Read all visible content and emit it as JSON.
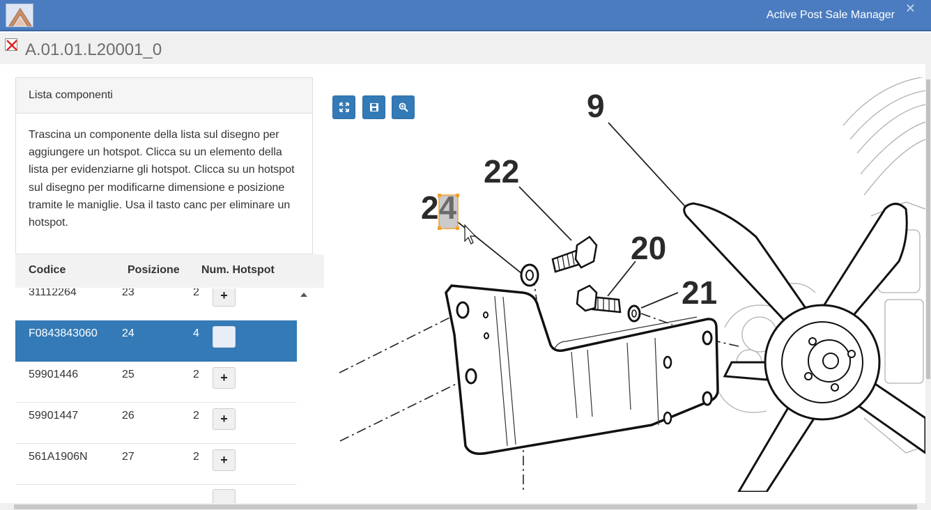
{
  "app": {
    "title": "Active Post Sale Manager",
    "close_glyph": "✕"
  },
  "document": {
    "title": "A.01.01.L20001_0"
  },
  "panel": {
    "heading": "Lista componenti",
    "instructions": "Trascina un componente della lista sul disegno per aggiungere un hotspot. Clicca su un elemento della lista per evidenziarne gli hotspot. Clicca su un hotspot sul disegno per modificarne dimensione e posizione tramite le maniglie. Usa il tasto canc per eliminare un hotspot."
  },
  "table": {
    "columns": [
      "Codice",
      "Posizione",
      "Num. Hotspot"
    ],
    "rows": [
      {
        "code": "31112264",
        "position": "23",
        "hotspots": "2",
        "button": "+"
      },
      {
        "code": "F0843843060",
        "position": "24",
        "hotspots": "4",
        "button": "+",
        "selected": true
      },
      {
        "code": "59901446",
        "position": "25",
        "hotspots": "2",
        "button": "+"
      },
      {
        "code": "59901447",
        "position": "26",
        "hotspots": "2",
        "button": "+"
      },
      {
        "code": "561A1906N",
        "position": "27",
        "hotspots": "2",
        "button": "+"
      }
    ]
  },
  "toolbar": {
    "buttons": [
      {
        "name": "fullscreen-button",
        "icon": "expand-icon"
      },
      {
        "name": "save-button",
        "icon": "floppy-disk-icon"
      },
      {
        "name": "zoom-button",
        "icon": "zoom-in-icon"
      }
    ]
  },
  "drawing": {
    "callouts": [
      "9",
      "22",
      "24",
      "20",
      "21"
    ]
  },
  "colors": {
    "titlebar": "#4b7cc0",
    "selection": "#337ab7",
    "hotspot": "#f0a030"
  }
}
